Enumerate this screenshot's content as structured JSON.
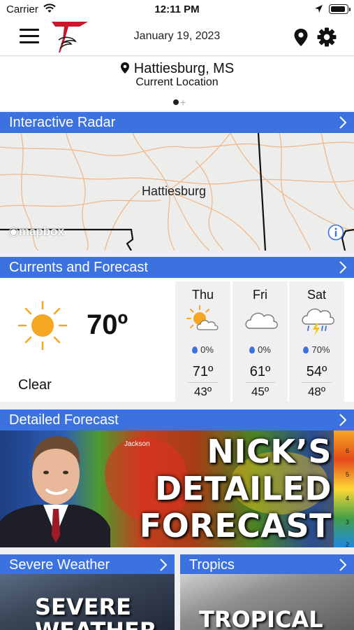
{
  "status_bar": {
    "carrier": "Carrier",
    "time": "12:11 PM"
  },
  "header": {
    "date": "January 19, 2023"
  },
  "location": {
    "city": "Hattiesburg, MS",
    "subtitle": "Current Location"
  },
  "sections": {
    "radar": "Interactive Radar",
    "currents": "Currents and Forecast",
    "detailed": "Detailed Forecast",
    "severe": "Severe Weather",
    "tropics": "Tropics"
  },
  "radar": {
    "place_label": "Hattiesburg",
    "attribution": "mapbox"
  },
  "current": {
    "temp": "70º",
    "condition": "Clear",
    "icon": "sun-icon"
  },
  "forecast": [
    {
      "day": "Thu",
      "icon": "partly-cloudy-icon",
      "precip": "0%",
      "high": "71º",
      "low": "43º"
    },
    {
      "day": "Fri",
      "icon": "cloud-icon",
      "precip": "0%",
      "high": "61º",
      "low": "45º"
    },
    {
      "day": "Sat",
      "icon": "thunderstorm-icon",
      "precip": "70%",
      "high": "54º",
      "low": "48º"
    }
  ],
  "promo": {
    "line1": "NICK’S",
    "line2": "DETAILED",
    "line3": "FORECAST",
    "map_label": "Jackson",
    "scale": [
      "6",
      "5",
      "4",
      "3",
      "2"
    ]
  },
  "tiles": {
    "severe_image_text": "SEVERE WEATHER",
    "tropics_image_text": "TROPICAL"
  },
  "colors": {
    "section_bar": "#3c72e0",
    "sun": "#f5a623",
    "drop": "#3c72e0"
  }
}
